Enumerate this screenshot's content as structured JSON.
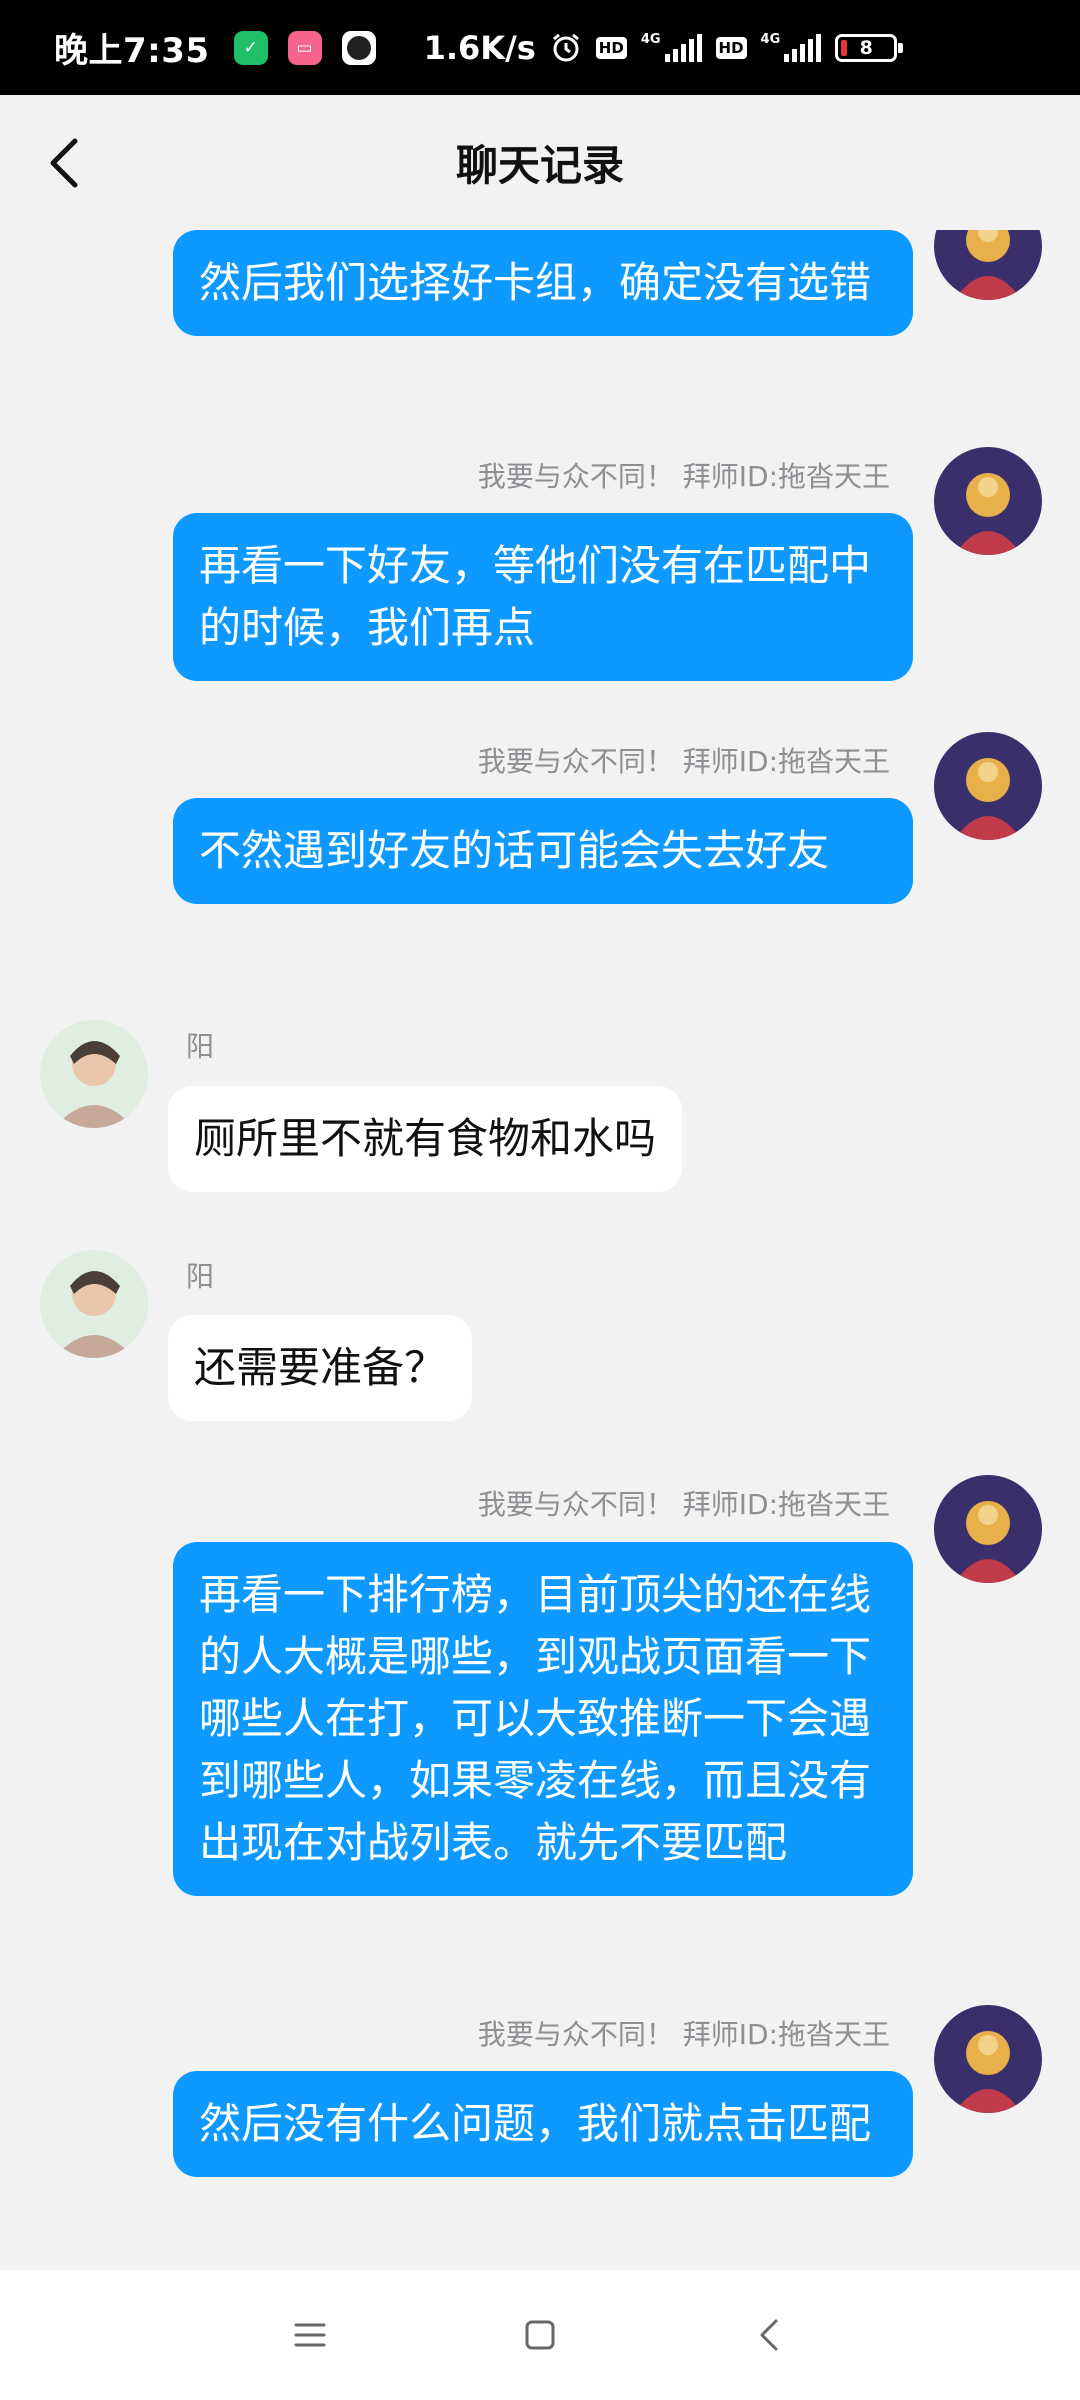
{
  "status_bar": {
    "time": "晚上7:35",
    "net_speed": "1.6K/s",
    "hd1": "HD",
    "net1": "4G",
    "hd2": "HD",
    "net2": "4G",
    "battery": "8"
  },
  "header": {
    "title": "聊天记录"
  },
  "messages": [
    {
      "side": "me",
      "text": "然后我们选择好卡组，确定没有选错"
    },
    {
      "side": "me",
      "sender": "我要与众不同！  拜师ID:拖沓天王",
      "text": "再看一下好友，等他们没有在匹配中的时候，我们再点"
    },
    {
      "side": "me",
      "sender": "我要与众不同！  拜师ID:拖沓天王",
      "text": "不然遇到好友的话可能会失去好友"
    },
    {
      "side": "other",
      "sender": "阳",
      "text": "厕所里不就有食物和水吗"
    },
    {
      "side": "other",
      "sender": "阳",
      "text": "还需要准备？"
    },
    {
      "side": "me",
      "sender": "我要与众不同！  拜师ID:拖沓天王",
      "text": "再看一下排行榜，目前顶尖的还在线的人大概是哪些，到观战页面看一下哪些人在打，可以大致推断一下会遇到哪些人，如果零凌在线，而且没有出现在对战列表。就先不要匹配"
    },
    {
      "side": "me",
      "sender": "我要与众不同！  拜师ID:拖沓天王",
      "text": "然后没有什么问题，我们就点击匹配"
    }
  ],
  "colors": {
    "my_bubble": "#0d99ff",
    "other_bubble": "#ffffff",
    "background": "#f2f2f3"
  }
}
